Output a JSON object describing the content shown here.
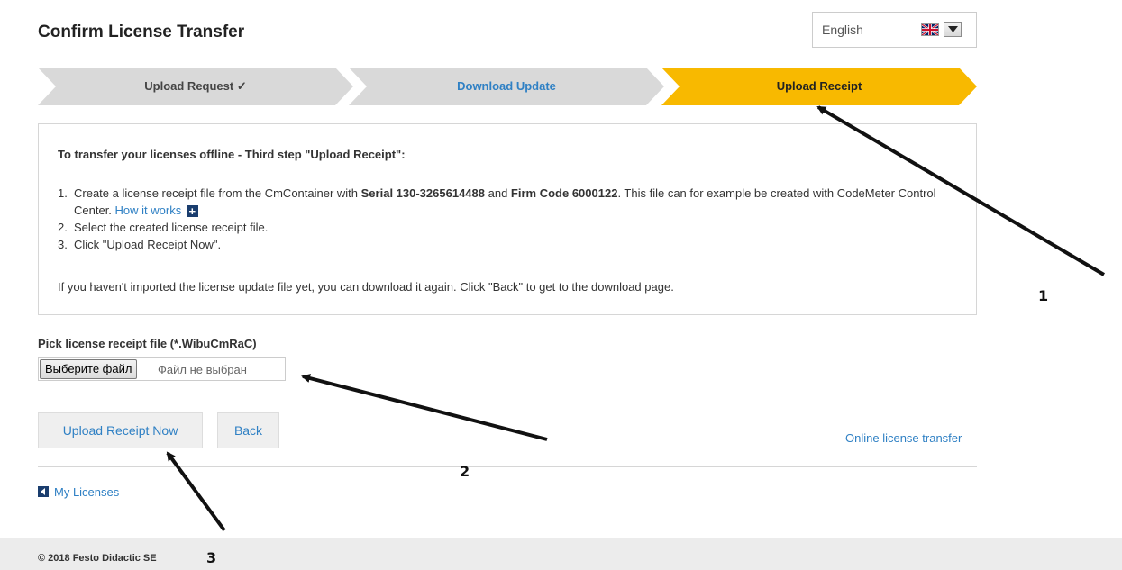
{
  "page": {
    "title": "Confirm License Transfer"
  },
  "language": {
    "value": "English",
    "flag_icon": "uk-flag-icon"
  },
  "steps": [
    {
      "label": "Upload Request ✓",
      "state": "done",
      "color": "#d9d9d9",
      "text_color": "#444444"
    },
    {
      "label": "Download Update",
      "state": "link",
      "color": "#d9d9d9",
      "text_color": "#2f80c4"
    },
    {
      "label": "Upload Receipt",
      "state": "active",
      "color": "#f8b900",
      "text_color": "#222222"
    }
  ],
  "info": {
    "heading": "To transfer your licenses offline - Third step \"Upload Receipt\":",
    "step1": {
      "num": "1.",
      "text_a": "Create a license receipt file from the CmContainer with ",
      "serial": "Serial 130-3265614488",
      "text_b": " and ",
      "firm": "Firm Code 6000122",
      "text_c": ". This file can for example be created with CodeMeter Control Center. ",
      "link": "How it works"
    },
    "step2": {
      "num": "2.",
      "text": "Select the created license receipt file."
    },
    "step3": {
      "num": "3.",
      "text": "Click \"Upload Receipt Now\"."
    },
    "note": "If you haven't imported the license update file yet, you can download it again. Click \"Back\" to get to the download page."
  },
  "file": {
    "label": "Pick license receipt file (*.WibuCmRaC)",
    "button": "Выберите файл",
    "status": "Файл не выбран"
  },
  "actions": {
    "upload": "Upload Receipt Now",
    "back": "Back",
    "online": "Online license transfer"
  },
  "nav": {
    "my_licenses": "My Licenses"
  },
  "footer": {
    "copyright": "© 2018 Festo Didactic SE"
  },
  "annotations": {
    "n1": "1",
    "n2": "2",
    "n3": "3"
  }
}
